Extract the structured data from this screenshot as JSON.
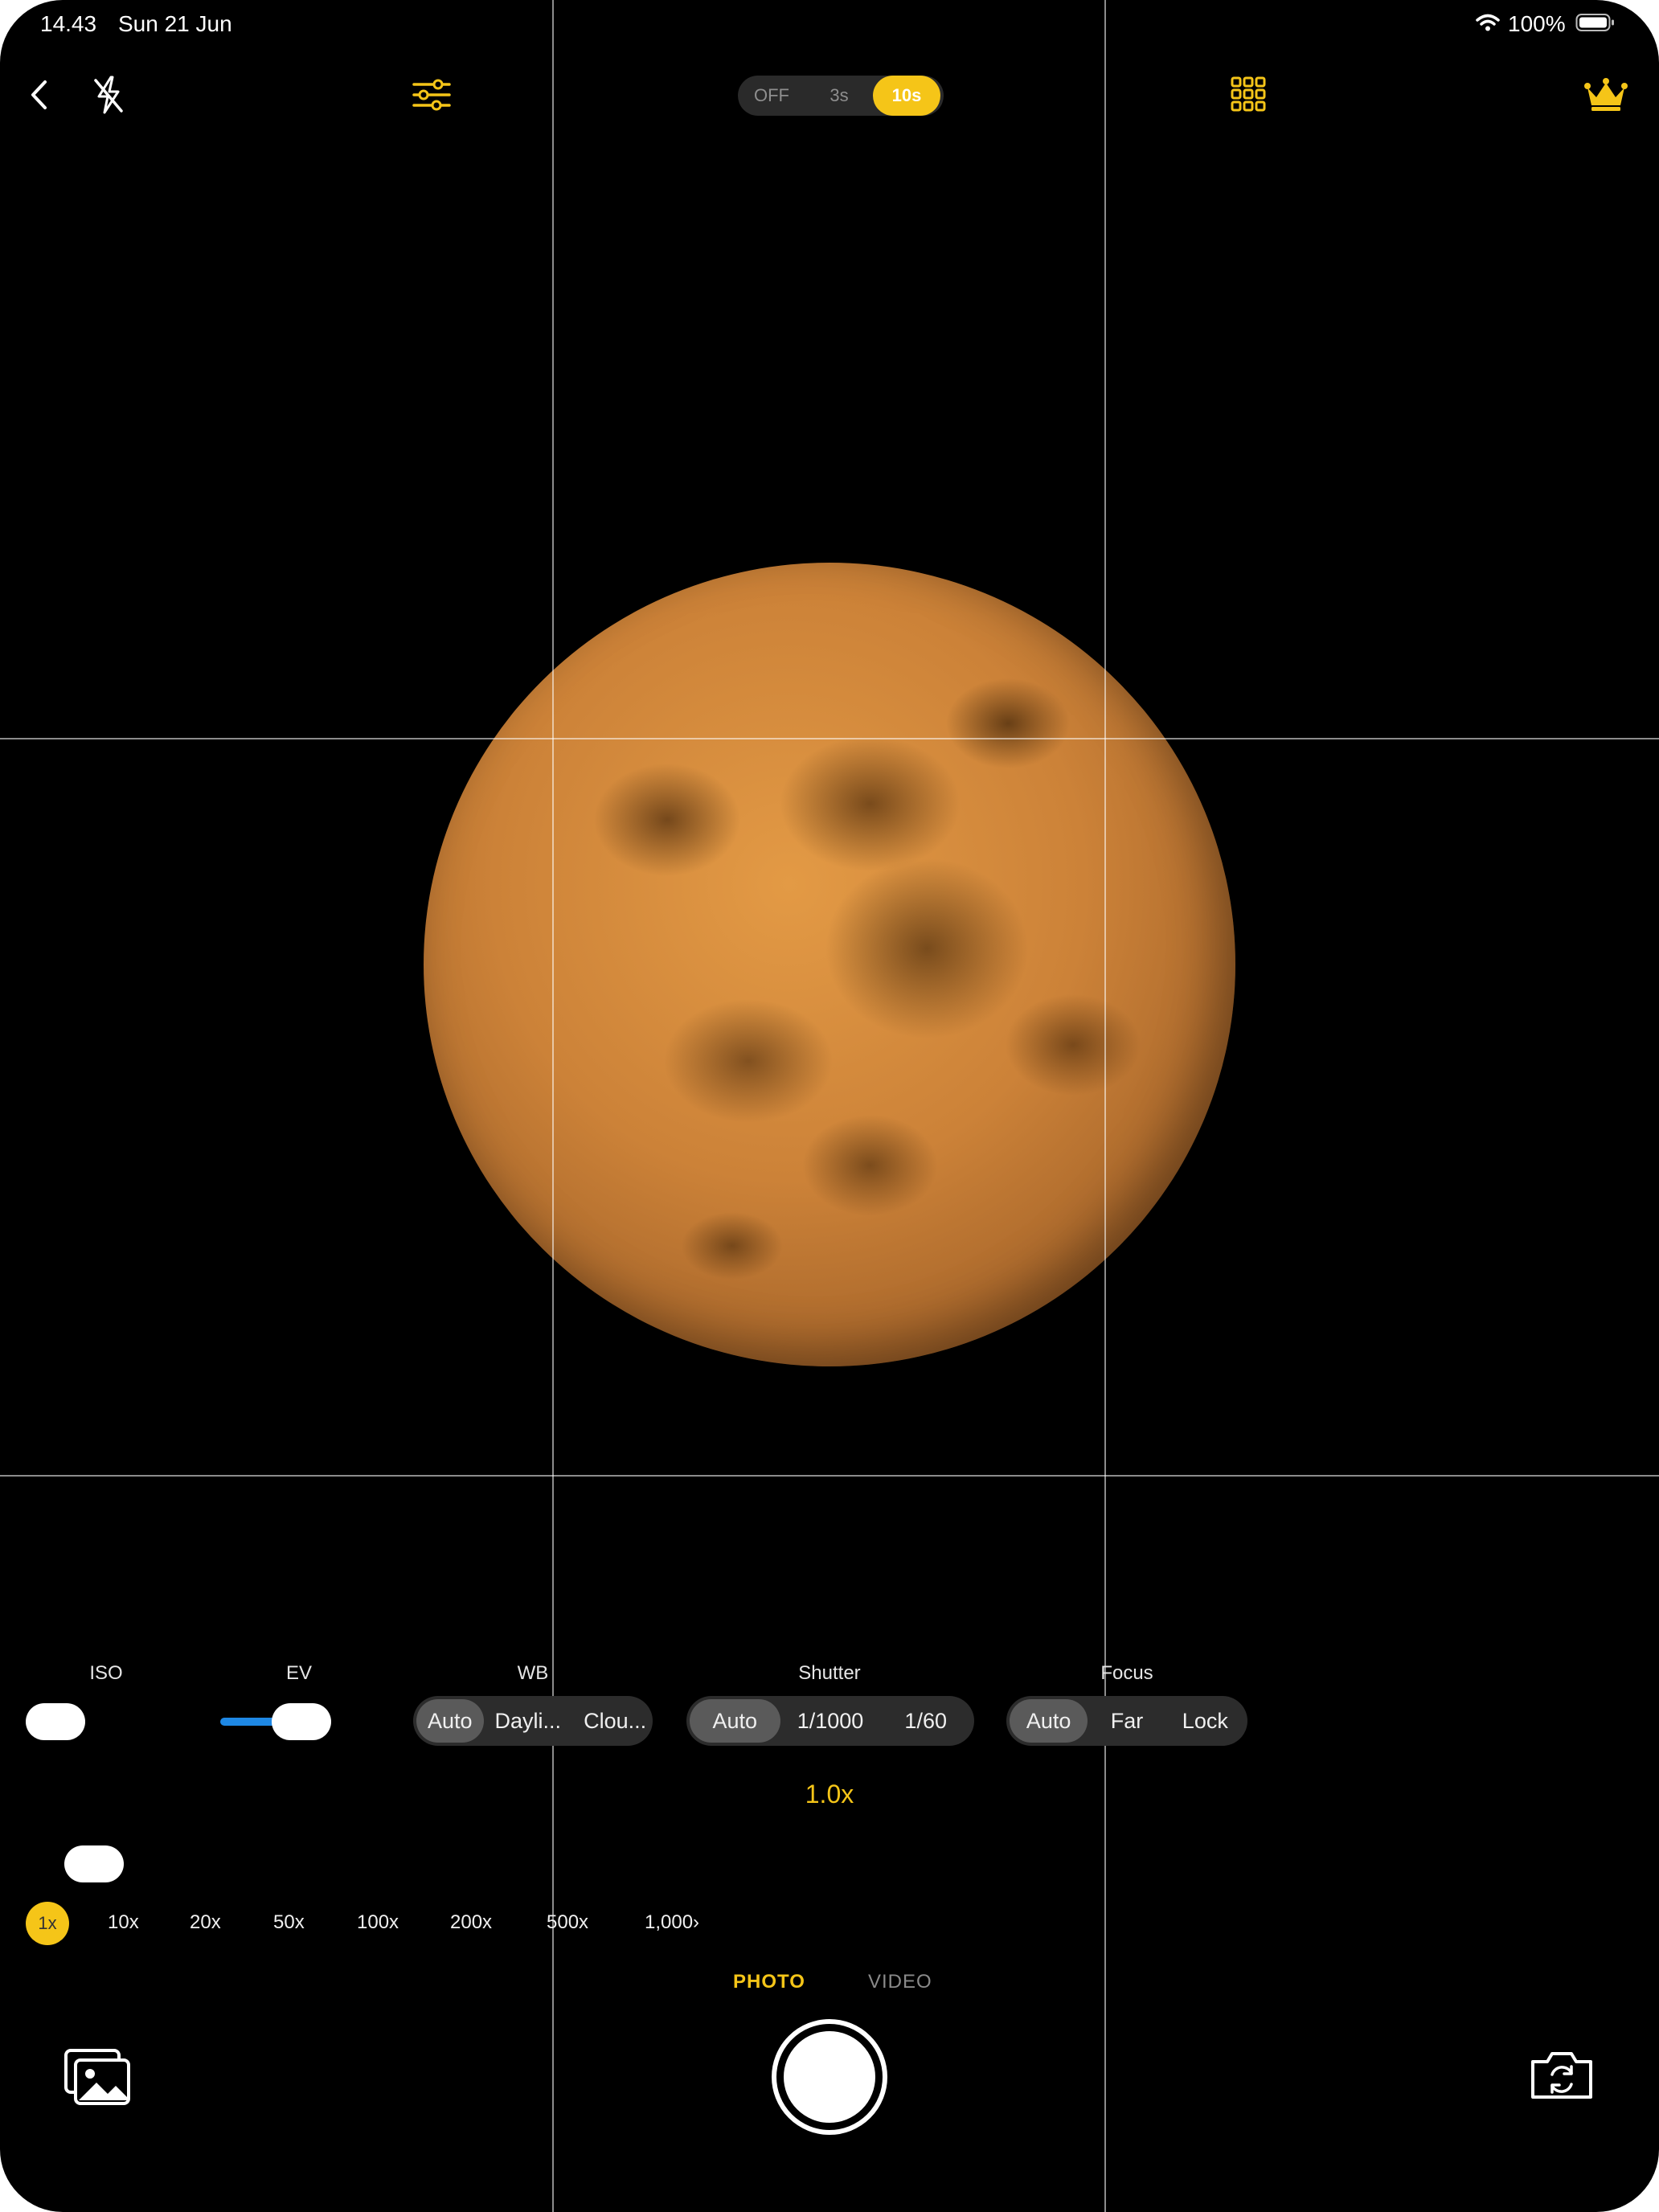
{
  "status_bar": {
    "time": "14.43",
    "date": "Sun 21 Jun",
    "battery": "100%"
  },
  "top_bar": {
    "icons": [
      "back-chevron-icon",
      "flash-off-icon",
      "adjustments-sliders-icon",
      "grid-icon",
      "crown-icon"
    ],
    "timer": {
      "options": [
        "OFF",
        "3s",
        "10s"
      ],
      "selected": "10s"
    }
  },
  "controls": {
    "iso": {
      "label": "ISO"
    },
    "ev": {
      "label": "EV"
    },
    "wb": {
      "label": "WB",
      "options": [
        "Auto",
        "Dayli...",
        "Clou..."
      ],
      "selected": "Auto"
    },
    "shutter": {
      "label": "Shutter",
      "options": [
        "Auto",
        "1/1000",
        "1/60"
      ],
      "selected": "Auto"
    },
    "focus": {
      "label": "Focus",
      "options": [
        "Auto",
        "Far",
        "Lock"
      ],
      "selected": "Auto"
    }
  },
  "zoom": {
    "readout": "1.0x",
    "levels": [
      "1x",
      "10x",
      "20x",
      "50x",
      "100x",
      "200x",
      "500x",
      "1,000›"
    ],
    "selected": "1x"
  },
  "modes": {
    "photo": "PHOTO",
    "video": "VIDEO",
    "selected": "PHOTO"
  },
  "colors": {
    "accent": "#f5c518",
    "background": "#000000",
    "ev_track": "#1e88e5"
  }
}
